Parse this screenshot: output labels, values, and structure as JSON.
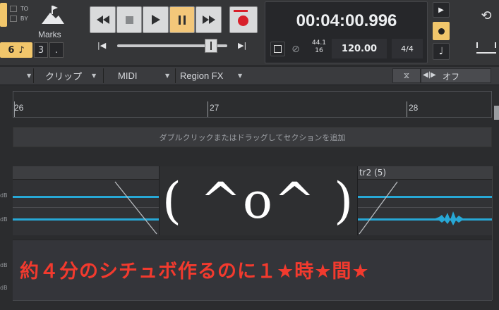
{
  "transport": {
    "to_label": "TO",
    "by_label": "BY",
    "marks_label": "Marks",
    "note_value": "6",
    "beat_value": "3",
    "dot_value": ".",
    "time_display": "00:04:00.996",
    "sample_rate": "44.1",
    "bit_depth": "16",
    "tempo": "120.00",
    "meter": "4/4",
    "transport_colors": {
      "rewind": "#2e2f31",
      "play": "#2e2f31",
      "pause_bg": "#f3c77a",
      "record": "#d8202a"
    }
  },
  "toolbar": {
    "clip_label": "クリップ",
    "midi_label": "MIDI",
    "regionfx_label": "Region FX",
    "off_label": "オフ"
  },
  "timeline": {
    "ticks": [
      "26",
      "27",
      "28"
    ],
    "section_hint": "ダブルクリックまたはドラッグしてセクションを追加"
  },
  "track": {
    "clip_name": "tr2 (5)",
    "db_labels": [
      "dB",
      "dB",
      "dB",
      "dB"
    ]
  },
  "overlay": {
    "face": "( ^o^ )",
    "caption": "約４分のシチュボ作るのに１★時★間★"
  }
}
